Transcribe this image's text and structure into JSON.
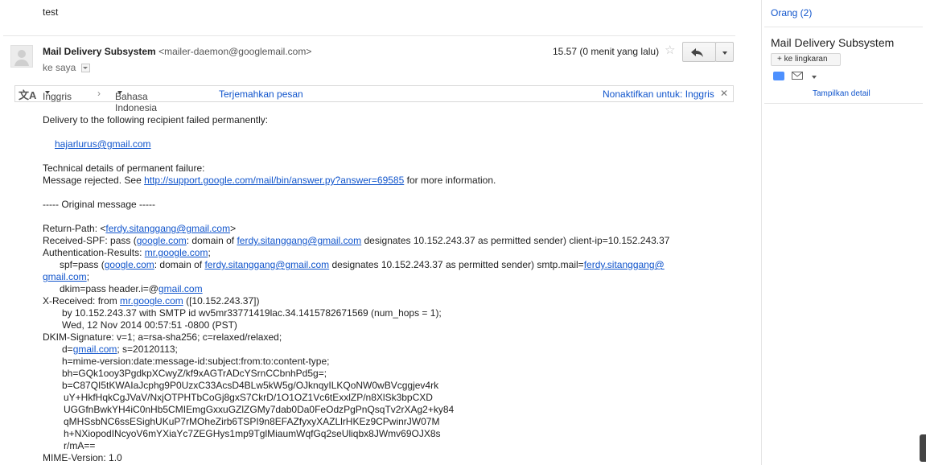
{
  "subject_fragment": "test",
  "message": {
    "sender_name": "Mail Delivery Subsystem",
    "sender_email": "<mailer-daemon@googlemail.com>",
    "to_label": "ke saya",
    "time": "15.57 (0 menit yang lalu)"
  },
  "translate_bar": {
    "source_lang": "Inggris",
    "target_lang": "Bahasa Indonesia",
    "translate_link": "Terjemahkan pesan",
    "disable_link": "Nonaktifkan untuk: Inggris"
  },
  "body": {
    "l1": "Delivery to the following recipient failed permanently:",
    "recipient": "hajarlurus@gmail.com",
    "l3": "Technical details of permanent failure:",
    "l4a": "Message rejected.  See ",
    "l4link": "http://support.google.com/mail/bin/answer.py?answer=69585",
    "l4b": " for more information.",
    "orig": "----- Original message -----",
    "rp_a": "Return-Path: <",
    "rp_link": "ferdy.sitanggang@gmail.com",
    "rp_b": ">",
    "spf_a": "Received-SPF: pass (",
    "spf_l1": "google.com",
    "spf_b": ": domain of ",
    "spf_l2": "ferdy.sitanggang@gmail.com",
    "spf_c": " designates 10.152.243.37 as permitted sender) client-ip=10.152.243.37",
    "ar_a": "Authentication-Results: ",
    "ar_link": "mr.google.com",
    "ar_b": ";",
    "s2_a": "spf=pass (",
    "s2_l1": "google.com",
    "s2_b": ": domain of ",
    "s2_l2": "ferdy.sitanggang@gmail.com",
    "s2_c": " designates 10.152.243.37 as permitted sender) smtp.mail=",
    "s2_l3": "ferdy.sitanggang@",
    "s3_link": "gmail.com",
    "s3_b": ";",
    "dk_a": "dkim=pass header.i=@",
    "dk_link": "gmail.com",
    "xr_a": "X-Received: from ",
    "xr_link": "mr.google.com",
    "xr_b": " ([10.152.243.37])",
    "xr2": "by 10.152.243.37 with SMTP id wv5mr33771419lac.34.1415782671569 (num_hops = 1);",
    "xr3": "Wed, 12 Nov 2014 00:57:51 -0800 (PST)",
    "ds": "DKIM-Signature: v=1; a=rsa-sha256; c=relaxed/relaxed;",
    "dd_a": "d=",
    "dd_link": "gmail.com",
    "dd_b": "; s=20120113;",
    "h": "h=mime-version:date:message-id:subject:from:to:content-type;",
    "bh": "bh=GQk1ooy3PgdkpXCwyZ/kf9xAGTrADcYSrnCCbnhPd5g=;",
    "b1": "b=C87QI5tKWAIaJcphg9P0UzxC33AcsD4BLw5kW5g/OJknqyILKQoNW0wBVcggjev4rk",
    "b2": "uY+HkfHqkCgJVaV/NxjOTPHTbCoGj8gxS7CkrD/1O1OZ1Vc6tExxlZP/n8XlSk3bpCXD",
    "b3": "UGGfnBwkYH4iC0nHb5CMIEmgGxxuGZlZGMy7dab0Da0FeOdzPgPnQsqTv2rXAg2+ky84",
    "b4": "qMHSsbNC6ssESighUKuP7rMOheZirb6TSPI9n8EFAZfyxyXAZLlrHKEz9CPwinrJW07M",
    "b5": "h+NXiopodINcyoV6mYXiaYc7ZEGHys1mp9TglMiaumWqfGq2seUliqbx8JWmv69OJX8s",
    "b6": "r/mA==",
    "mime": "MIME-Version: 1.0"
  },
  "sidebar": {
    "people_link": "Orang (2)",
    "contact_name": "Mail Delivery Subsystem",
    "add_circle": "+ ke lingkaran",
    "details_link": "Tampilkan detail"
  }
}
